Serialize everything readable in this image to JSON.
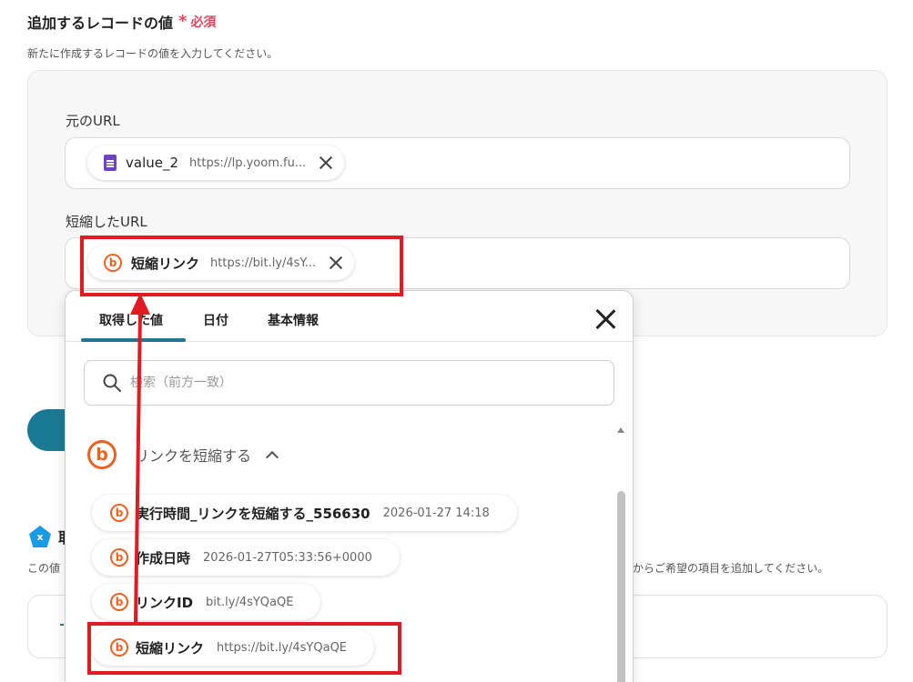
{
  "section": {
    "title": "追加するレコードの値",
    "required_mark": "*",
    "required_label": "必須",
    "description": "新たに作成するレコードの値を入力してください。"
  },
  "fields": [
    {
      "label": "元のURL",
      "chip": {
        "icon": "google-forms-icon",
        "name": "value_2",
        "value": "https://lp.yoom.fu..."
      }
    },
    {
      "label": "短縮したURL",
      "chip": {
        "icon": "bitly-icon",
        "name": "短縮リンク",
        "value": "https://bit.ly/4sY..."
      }
    }
  ],
  "dropdown": {
    "tabs": [
      "取得した値",
      "日付",
      "基本情報"
    ],
    "active_tab": 0,
    "search_placeholder": "検索（前方一致）",
    "group_label": "リンクを短縮する",
    "items": [
      {
        "name": "実行時間_リンクを短縮する_556630",
        "value": "2026-01-27 14:18"
      },
      {
        "name": "作成日時",
        "value": "2026-01-27T05:33:56+0000"
      },
      {
        "name": "リンクID",
        "value": "bit.ly/4sYQaQE"
      },
      {
        "name": "短縮リンク",
        "value": "https://bit.ly/4sYQaQE"
      }
    ]
  },
  "background": {
    "second_title": "取",
    "left_desc": "この値",
    "right_desc": "からご希望の項目を追加してください。"
  },
  "colors": {
    "required": "#e0475a",
    "accent": "#1b7a93",
    "bitly": "#ee6123",
    "highlight": "#e01b22"
  }
}
